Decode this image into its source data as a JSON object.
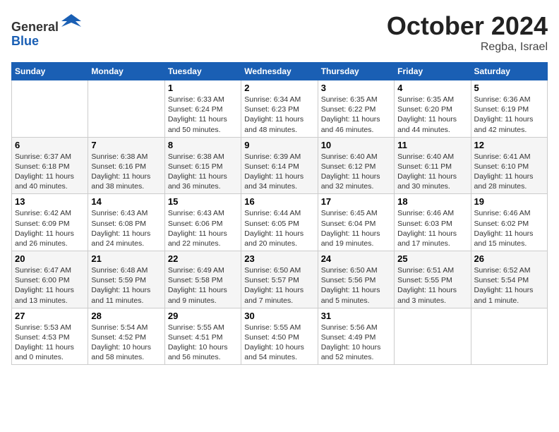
{
  "header": {
    "logo_line1": "General",
    "logo_line2": "Blue",
    "month": "October 2024",
    "location": "Regba, Israel"
  },
  "days_of_week": [
    "Sunday",
    "Monday",
    "Tuesday",
    "Wednesday",
    "Thursday",
    "Friday",
    "Saturday"
  ],
  "weeks": [
    [
      {
        "day": "",
        "info": ""
      },
      {
        "day": "",
        "info": ""
      },
      {
        "day": "1",
        "info": "Sunrise: 6:33 AM\nSunset: 6:24 PM\nDaylight: 11 hours and 50 minutes."
      },
      {
        "day": "2",
        "info": "Sunrise: 6:34 AM\nSunset: 6:23 PM\nDaylight: 11 hours and 48 minutes."
      },
      {
        "day": "3",
        "info": "Sunrise: 6:35 AM\nSunset: 6:22 PM\nDaylight: 11 hours and 46 minutes."
      },
      {
        "day": "4",
        "info": "Sunrise: 6:35 AM\nSunset: 6:20 PM\nDaylight: 11 hours and 44 minutes."
      },
      {
        "day": "5",
        "info": "Sunrise: 6:36 AM\nSunset: 6:19 PM\nDaylight: 11 hours and 42 minutes."
      }
    ],
    [
      {
        "day": "6",
        "info": "Sunrise: 6:37 AM\nSunset: 6:18 PM\nDaylight: 11 hours and 40 minutes."
      },
      {
        "day": "7",
        "info": "Sunrise: 6:38 AM\nSunset: 6:16 PM\nDaylight: 11 hours and 38 minutes."
      },
      {
        "day": "8",
        "info": "Sunrise: 6:38 AM\nSunset: 6:15 PM\nDaylight: 11 hours and 36 minutes."
      },
      {
        "day": "9",
        "info": "Sunrise: 6:39 AM\nSunset: 6:14 PM\nDaylight: 11 hours and 34 minutes."
      },
      {
        "day": "10",
        "info": "Sunrise: 6:40 AM\nSunset: 6:12 PM\nDaylight: 11 hours and 32 minutes."
      },
      {
        "day": "11",
        "info": "Sunrise: 6:40 AM\nSunset: 6:11 PM\nDaylight: 11 hours and 30 minutes."
      },
      {
        "day": "12",
        "info": "Sunrise: 6:41 AM\nSunset: 6:10 PM\nDaylight: 11 hours and 28 minutes."
      }
    ],
    [
      {
        "day": "13",
        "info": "Sunrise: 6:42 AM\nSunset: 6:09 PM\nDaylight: 11 hours and 26 minutes."
      },
      {
        "day": "14",
        "info": "Sunrise: 6:43 AM\nSunset: 6:08 PM\nDaylight: 11 hours and 24 minutes."
      },
      {
        "day": "15",
        "info": "Sunrise: 6:43 AM\nSunset: 6:06 PM\nDaylight: 11 hours and 22 minutes."
      },
      {
        "day": "16",
        "info": "Sunrise: 6:44 AM\nSunset: 6:05 PM\nDaylight: 11 hours and 20 minutes."
      },
      {
        "day": "17",
        "info": "Sunrise: 6:45 AM\nSunset: 6:04 PM\nDaylight: 11 hours and 19 minutes."
      },
      {
        "day": "18",
        "info": "Sunrise: 6:46 AM\nSunset: 6:03 PM\nDaylight: 11 hours and 17 minutes."
      },
      {
        "day": "19",
        "info": "Sunrise: 6:46 AM\nSunset: 6:02 PM\nDaylight: 11 hours and 15 minutes."
      }
    ],
    [
      {
        "day": "20",
        "info": "Sunrise: 6:47 AM\nSunset: 6:00 PM\nDaylight: 11 hours and 13 minutes."
      },
      {
        "day": "21",
        "info": "Sunrise: 6:48 AM\nSunset: 5:59 PM\nDaylight: 11 hours and 11 minutes."
      },
      {
        "day": "22",
        "info": "Sunrise: 6:49 AM\nSunset: 5:58 PM\nDaylight: 11 hours and 9 minutes."
      },
      {
        "day": "23",
        "info": "Sunrise: 6:50 AM\nSunset: 5:57 PM\nDaylight: 11 hours and 7 minutes."
      },
      {
        "day": "24",
        "info": "Sunrise: 6:50 AM\nSunset: 5:56 PM\nDaylight: 11 hours and 5 minutes."
      },
      {
        "day": "25",
        "info": "Sunrise: 6:51 AM\nSunset: 5:55 PM\nDaylight: 11 hours and 3 minutes."
      },
      {
        "day": "26",
        "info": "Sunrise: 6:52 AM\nSunset: 5:54 PM\nDaylight: 11 hours and 1 minute."
      }
    ],
    [
      {
        "day": "27",
        "info": "Sunrise: 5:53 AM\nSunset: 4:53 PM\nDaylight: 11 hours and 0 minutes."
      },
      {
        "day": "28",
        "info": "Sunrise: 5:54 AM\nSunset: 4:52 PM\nDaylight: 10 hours and 58 minutes."
      },
      {
        "day": "29",
        "info": "Sunrise: 5:55 AM\nSunset: 4:51 PM\nDaylight: 10 hours and 56 minutes."
      },
      {
        "day": "30",
        "info": "Sunrise: 5:55 AM\nSunset: 4:50 PM\nDaylight: 10 hours and 54 minutes."
      },
      {
        "day": "31",
        "info": "Sunrise: 5:56 AM\nSunset: 4:49 PM\nDaylight: 10 hours and 52 minutes."
      },
      {
        "day": "",
        "info": ""
      },
      {
        "day": "",
        "info": ""
      }
    ]
  ]
}
